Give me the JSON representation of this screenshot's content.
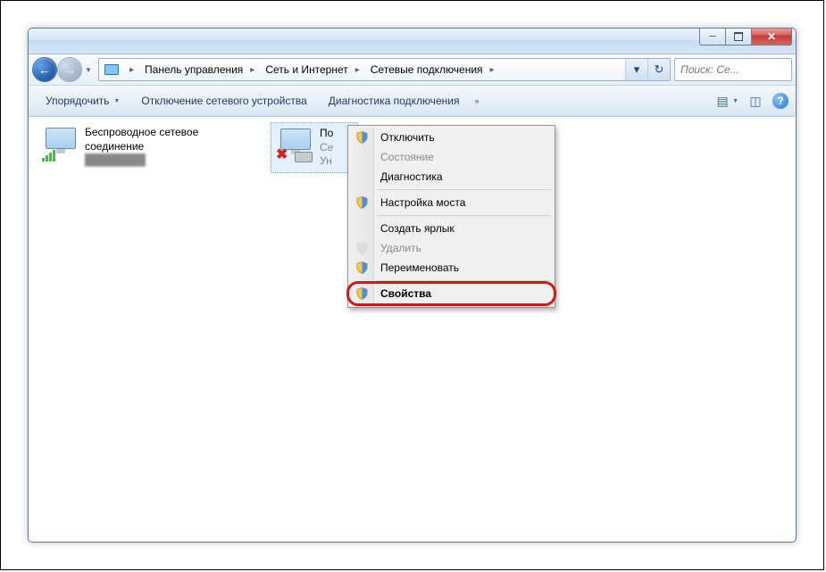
{
  "breadcrumbs": {
    "level1": "Панель управления",
    "level2": "Сеть и Интернет",
    "level3": "Сетевые подключения"
  },
  "search": {
    "placeholder": "Поиск: Се..."
  },
  "toolbar": {
    "organize": "Упорядочить",
    "disable_device": "Отключение сетевого устройства",
    "diagnose": "Диагностика подключения"
  },
  "connections": {
    "wireless": {
      "title": "Беспроводное сетевое соединение",
      "subtitle": ""
    },
    "lan": {
      "title": "По",
      "line2": "Се",
      "line3": "Ун"
    }
  },
  "context_menu": {
    "disable": "Отключить",
    "status": "Состояние",
    "diagnose": "Диагностика",
    "bridge": "Настройка моста",
    "shortcut": "Создать ярлык",
    "delete": "Удалить",
    "rename": "Переименовать",
    "properties": "Свойства"
  }
}
